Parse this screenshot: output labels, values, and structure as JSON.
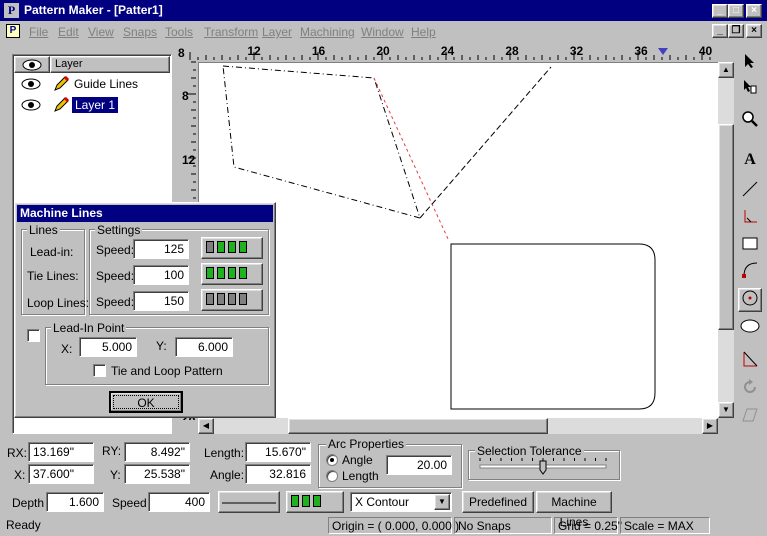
{
  "window": {
    "title": "Pattern Maker - [Patter1]",
    "app_icon": "P",
    "min": "_",
    "max": "□",
    "close": "×"
  },
  "menu": [
    "File",
    "Edit",
    "View",
    "Snaps",
    "Tools",
    "Transform",
    "Layer",
    "Machining",
    "Window",
    "Help"
  ],
  "mdi": {
    "min": "_",
    "restore": "❐",
    "close": "×"
  },
  "layers": {
    "header": "Layer",
    "items": [
      {
        "name": "Guide Lines",
        "selected": false
      },
      {
        "name": "Layer 1",
        "selected": true
      }
    ]
  },
  "ruler": {
    "h_ticks": [
      "8",
      "12",
      "16",
      "20",
      "24",
      "28",
      "32",
      "36",
      "40"
    ],
    "v_ticks": [
      "8",
      "12",
      "28"
    ]
  },
  "machine_lines": {
    "title": "Machine Lines",
    "lines_group": "Lines",
    "settings_group": "Settings",
    "rows": [
      {
        "label": "Lead-in:",
        "speed_label": "Speed:",
        "speed": "125",
        "lamps": [
          false,
          true,
          true,
          true
        ]
      },
      {
        "label": "Tie Lines:",
        "speed_label": "Speed:",
        "speed": "100",
        "lamps": [
          true,
          true,
          true,
          true
        ]
      },
      {
        "label": "Loop Lines:",
        "speed_label": "Speed:",
        "speed": "150",
        "lamps": [
          false,
          false,
          false,
          false
        ]
      }
    ],
    "lead_in_point": "Lead-In Point",
    "x_label": "X:",
    "x": "5.000",
    "y_label": "Y:",
    "y": "6.000",
    "tie_loop": "Tie and Loop Pattern",
    "ok": "OK"
  },
  "props": {
    "rx_label": "RX:",
    "rx": "13.169\"",
    "ry_label": "RY:",
    "ry": "8.492\"",
    "length_label": "Length:",
    "length": "15.670\"",
    "x_label": "X:",
    "x": "37.600\"",
    "y_label": "Y:",
    "y": "25.538\"",
    "angle_label": "Angle:",
    "angle": "32.816",
    "arc_group": "Arc Properties",
    "arc_angle": "Angle",
    "arc_length": "Length",
    "arc_value": "20.00",
    "tolerance_group": "Selection Tolerance",
    "tolerance_level": 0.5
  },
  "toolbar2": {
    "depth_label": "Depth",
    "depth": "1.600",
    "speed_label": "Speed",
    "speed": "400",
    "contour": "X Contour",
    "predefined": "Predefined",
    "machine_lines": "Machine Lines"
  },
  "status": {
    "ready": "Ready",
    "origin": "Origin = ( 0.000, 0.000 )",
    "snaps": "No Snaps",
    "grid": "Grid = 0.25\"",
    "scale": "Scale = MAX"
  },
  "colors": {
    "titlebar": "#000080",
    "lamp_on": "#20b020",
    "lamp_off": "#808080",
    "guide_line": "#e04040"
  },
  "icons": [
    "eye-icon",
    "pencil-icon",
    "arrow-select-icon",
    "node-select-icon",
    "zoom-icon",
    "text-icon",
    "line-icon",
    "corner-icon",
    "rectangle-icon",
    "arc-icon",
    "circle-icon",
    "ellipse-icon",
    "triangle-icon",
    "rotate-icon",
    "parallelogram-icon"
  ]
}
